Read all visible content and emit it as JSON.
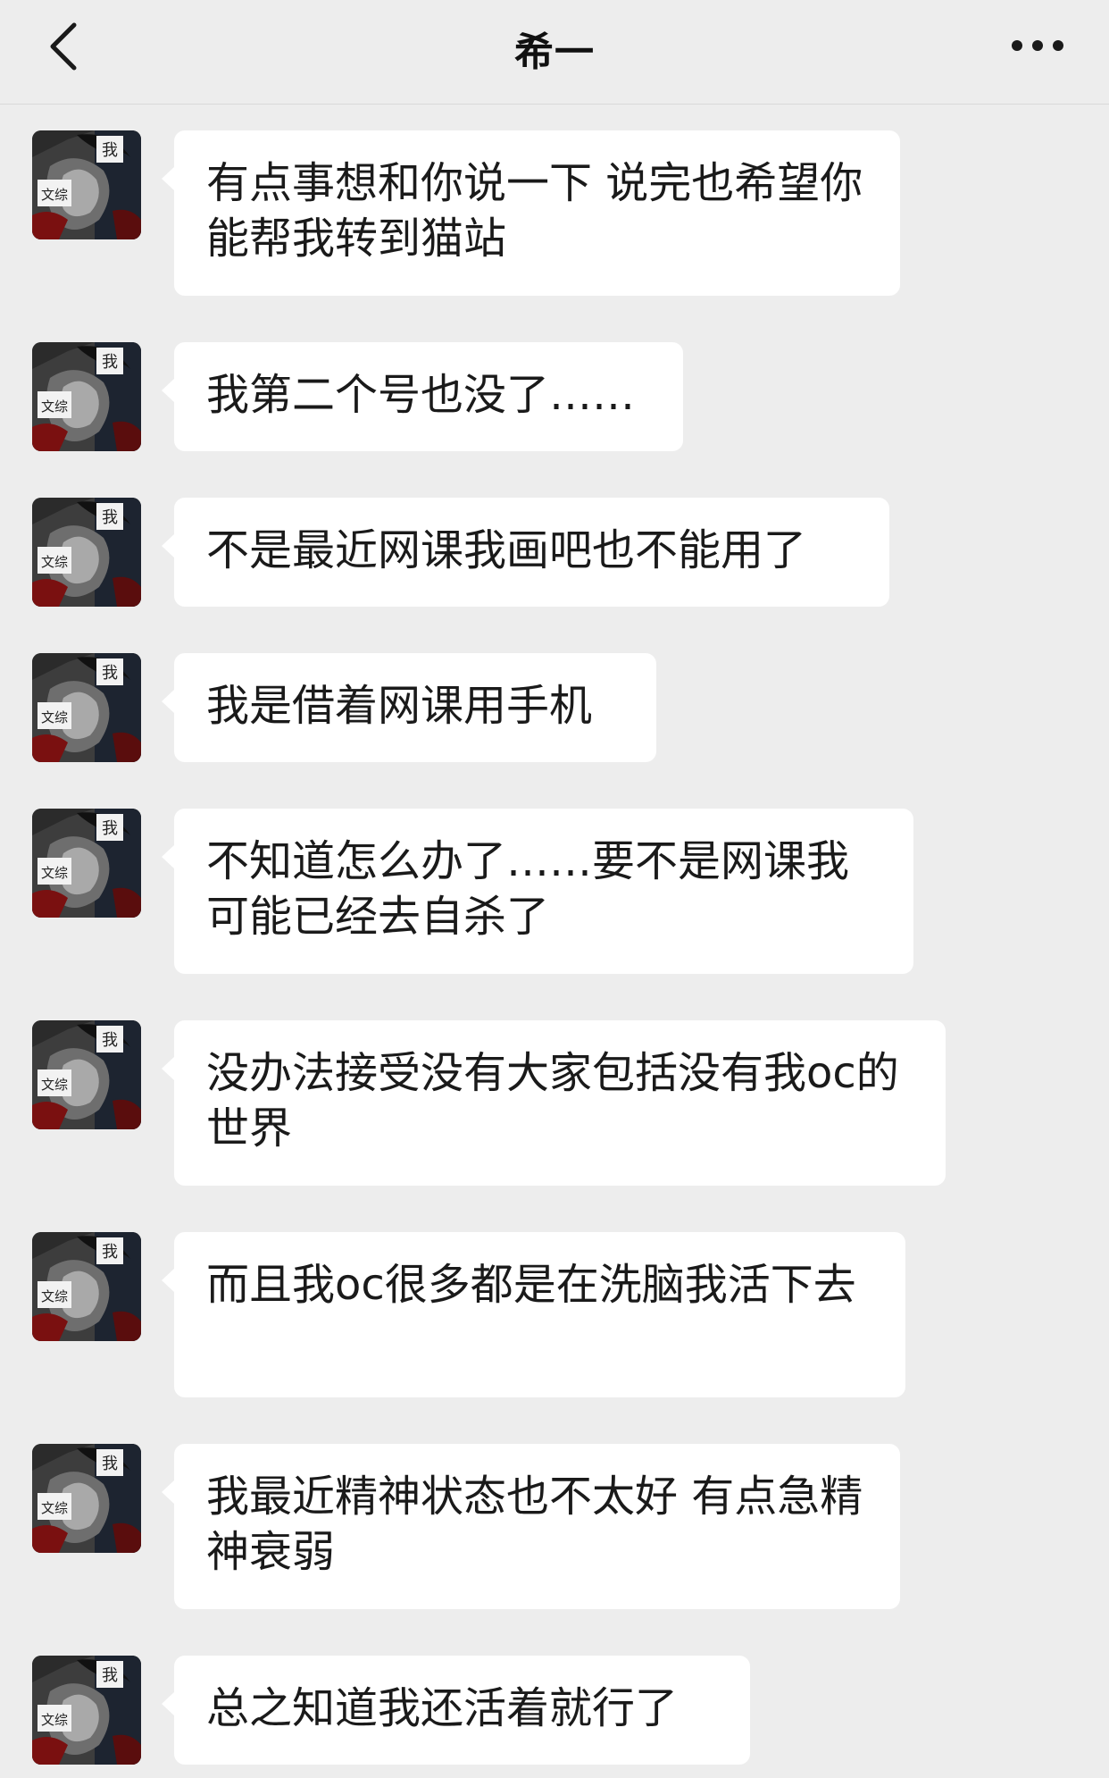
{
  "header": {
    "title": "希一",
    "back_icon": "chevron-left-icon",
    "more_icon": "more-dots-icon"
  },
  "avatar": {
    "label_top": "我",
    "label_bottom": "文综"
  },
  "messages": [
    {
      "text": "有点事想和你说一下 说完也希望你能帮我转到猫站"
    },
    {
      "text": "我第二个号也没了……"
    },
    {
      "text": "不是最近网课我画吧也不能用了"
    },
    {
      "text": "我是借着网课用手机"
    },
    {
      "text": "不知道怎么办了……要不是网课我可能已经去自杀了"
    },
    {
      "text": "没办法接受没有大家包括没有我oc的世界"
    },
    {
      "text": "而且我oc很多都是在洗脑我活下去"
    },
    {
      "text": "我最近精神状态也不太好 有点急精神衰弱"
    },
    {
      "text": "总之知道我还活着就行了"
    }
  ]
}
